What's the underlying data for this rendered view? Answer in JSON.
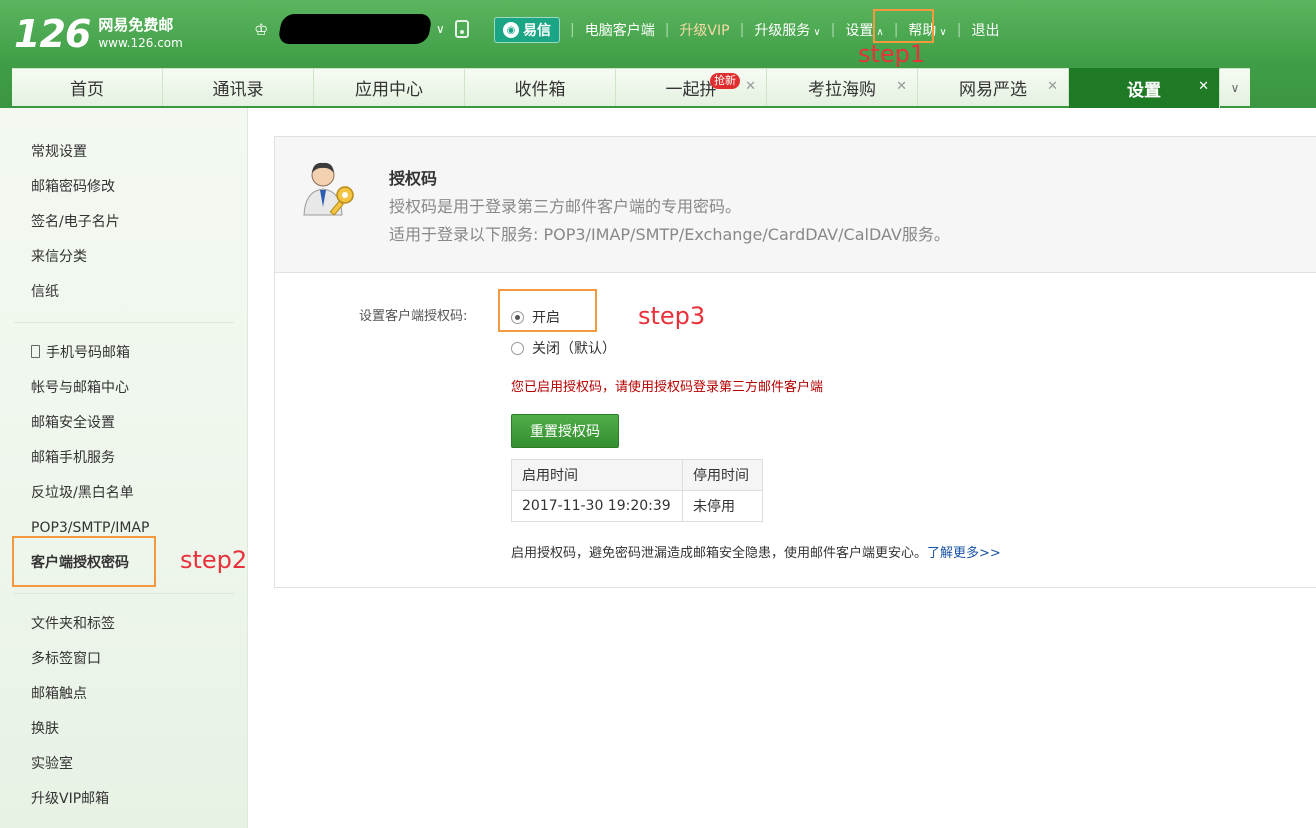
{
  "brand": {
    "number": "126",
    "name": "网易免费邮",
    "url": "www.126.com"
  },
  "topnav": {
    "yixin": "易信",
    "desktop_client": "电脑客户端",
    "vip": "升级VIP",
    "upgrade_service": "升级服务",
    "settings": "设置",
    "help": "帮助",
    "logout": "退出"
  },
  "tabs": [
    {
      "label": "首页"
    },
    {
      "label": "通讯录"
    },
    {
      "label": "应用中心"
    },
    {
      "label": "收件箱"
    },
    {
      "label": "一起拼",
      "badge": "抢新"
    },
    {
      "label": "考拉海购"
    },
    {
      "label": "网易严选"
    },
    {
      "label": "设置"
    }
  ],
  "sidebar": {
    "group1": [
      "常规设置",
      "邮箱密码修改",
      "签名/电子名片",
      "来信分类",
      "信纸"
    ],
    "group2": [
      "手机号码邮箱",
      "帐号与邮箱中心",
      "邮箱安全设置",
      "邮箱手机服务",
      "反垃圾/黑白名单",
      "POP3/SMTP/IMAP",
      "客户端授权密码"
    ],
    "group3": [
      "文件夹和标签",
      "多标签窗口",
      "邮箱触点",
      "换肤",
      "实验室",
      "升级VIP邮箱"
    ]
  },
  "annotations": {
    "step1": "step1",
    "step2": "step2",
    "step3": "step3"
  },
  "main": {
    "title": "授权码",
    "desc1": "授权码是用于登录第三方邮件客户端的专用密码。",
    "desc2": "适用于登录以下服务: POP3/IMAP/SMTP/Exchange/CardDAV/CalDAV服务。",
    "form_label": "设置客户端授权码:",
    "option_on": "开启",
    "option_off": "关闭（默认）",
    "notice": "您已启用授权码，请使用授权码登录第三方邮件客户端",
    "reset_button": "重置授权码",
    "table": {
      "headers": [
        "启用时间",
        "停用时间"
      ],
      "row": [
        "2017-11-30 19:20:39",
        "未停用"
      ]
    },
    "footer_text": "启用授权码，避免密码泄漏造成邮箱安全隐患，使用邮件客户端更安心。",
    "learn_more": "了解更多>>"
  },
  "colors": {
    "header_green": "#3f9e45",
    "active_tab": "#1f7a25",
    "annotation_orange": "#f39a3e",
    "annotation_red": "#e8313a",
    "notice_red": "#b50000"
  }
}
